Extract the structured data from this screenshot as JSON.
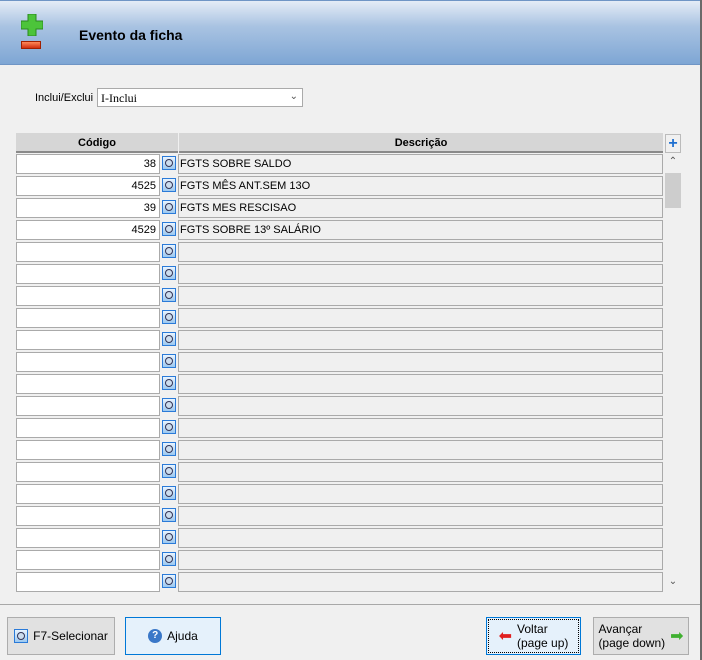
{
  "header": {
    "title": "Evento da ficha"
  },
  "form": {
    "label": "Inclui/Exclui",
    "value": "I-Inclui"
  },
  "table": {
    "headers": [
      "Código",
      "Descrição"
    ],
    "rows": [
      {
        "code": "38",
        "desc": "FGTS SOBRE SALDO"
      },
      {
        "code": "4525",
        "desc": "FGTS MÊS ANT.SEM 13O"
      },
      {
        "code": "39",
        "desc": "FGTS MES RESCISAO"
      },
      {
        "code": "4529",
        "desc": "FGTS SOBRE 13º SALÁRIO"
      },
      {
        "code": "",
        "desc": ""
      },
      {
        "code": "",
        "desc": ""
      },
      {
        "code": "",
        "desc": ""
      },
      {
        "code": "",
        "desc": ""
      },
      {
        "code": "",
        "desc": ""
      },
      {
        "code": "",
        "desc": ""
      },
      {
        "code": "",
        "desc": ""
      },
      {
        "code": "",
        "desc": ""
      },
      {
        "code": "",
        "desc": ""
      },
      {
        "code": "",
        "desc": ""
      },
      {
        "code": "",
        "desc": ""
      },
      {
        "code": "",
        "desc": ""
      },
      {
        "code": "",
        "desc": ""
      },
      {
        "code": "",
        "desc": ""
      },
      {
        "code": "",
        "desc": ""
      },
      {
        "code": "",
        "desc": ""
      }
    ]
  },
  "buttons": {
    "select": "F7-Selecionar",
    "help": "Ajuda",
    "back": "Voltar",
    "back_sub": "(page up)",
    "next": "Avançar",
    "next_sub": "(page down)"
  }
}
